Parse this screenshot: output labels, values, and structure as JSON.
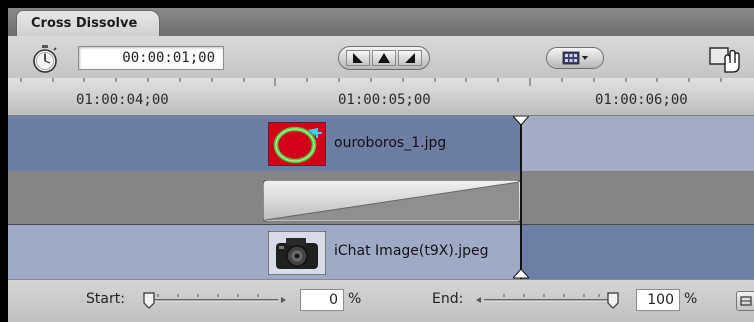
{
  "tab": {
    "label": "Cross Dissolve"
  },
  "toolbar": {
    "timecode": "00:00:01;00",
    "alignment_icons": [
      "align-start-icon",
      "align-center-icon",
      "align-end-icon"
    ],
    "popup_icon": "filmstrip-menu-icon",
    "drag_icon": "drag-hand-icon"
  },
  "ruler": {
    "labels": [
      "01:00:04;00",
      "01:00:05;00",
      "01:00:06;00"
    ]
  },
  "tracks": {
    "clip_a": {
      "name": "ouroboros_1.jpg",
      "icon": "ouroboros-thumbnail"
    },
    "clip_b": {
      "name": "iChat Image(t9X).jpeg",
      "icon": "camera-thumbnail"
    }
  },
  "bottom": {
    "start_label": "Start:",
    "start_value": "0",
    "start_fraction": 0,
    "end_label": "End:",
    "end_value": "100",
    "end_fraction": 1,
    "percent": "%"
  },
  "colors": {
    "track_dark": "#6c7ea3",
    "track_light": "#a2acc4",
    "transition_track": "#858585",
    "clip_a_thumb_bg": "#d4001a"
  }
}
